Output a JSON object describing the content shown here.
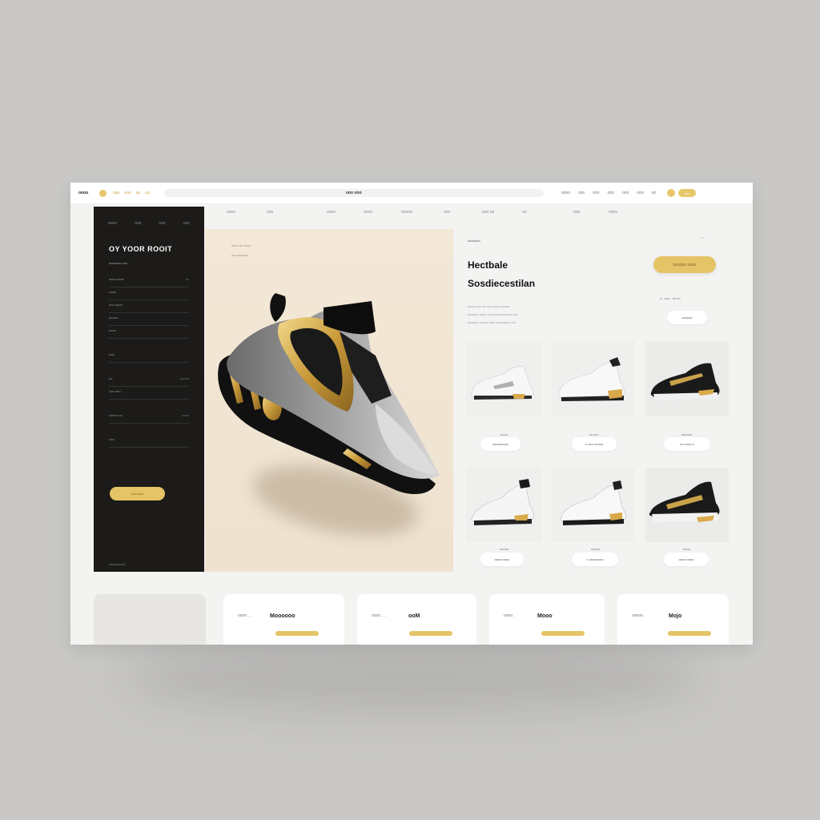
{
  "topbar": {
    "brand": "ooou",
    "nav": [
      "uuu",
      "uuu",
      "uu",
      "uu"
    ],
    "search_text": "ooo ooo",
    "right_nav": [
      "oooo",
      "ooo",
      "ooo",
      "ooo",
      "ooo",
      "ooo",
      "oo"
    ],
    "pill": "ooo"
  },
  "subnav": [
    "oooo",
    "ooo",
    "oooo",
    "oooo",
    "ooooo",
    "ooo",
    "ooo oo",
    "oo",
    "ooo",
    "oooo"
  ],
  "sidebar": {
    "tabs": [
      "oooo",
      "ooo",
      "ooo",
      "ooo"
    ],
    "title": "OY YOOR ROOIT",
    "subtitle": "ooooooo ooo",
    "rows": [
      {
        "label": "oooo oooo",
        "right": "oo"
      },
      {
        "label": "oooo",
        "right": ""
      },
      {
        "label": "ooo oooo",
        "right": ""
      },
      {
        "label": "ooooo",
        "right": ""
      },
      {
        "label": "oooo",
        "right": ""
      },
      {
        "label": "ooo",
        "right": ""
      },
      {
        "label": "oo",
        "right": "ooooo"
      },
      {
        "label": "ooo ooo",
        "right": ""
      },
      {
        "label": "ooooo oo",
        "right": "oooo"
      },
      {
        "label": "ooo",
        "right": ""
      }
    ],
    "cta": "ooooooo",
    "footer": "ooooooooo"
  },
  "hero": {
    "label1": "oooo oo oooo",
    "label2": "ooo oooooo"
  },
  "product": {
    "tag": "ooooooo",
    "corner": "o  o",
    "title_line1": "Hectbale",
    "title_line2": "Sosdiecestilan",
    "description": [
      "oooo ooo oo ooo oooo ooooo",
      "oooooo oooo oo oooooooooooo oo",
      "oooooo ooooo ooo oooooooo ooo"
    ],
    "cta": "oooooo oooo",
    "price_row": "o . ooo . oo oo",
    "secondary_pill": "oooooo"
  },
  "grid": [
    {
      "caption": "oooo",
      "pill": "ooooooooo"
    },
    {
      "caption": "oo ooo",
      "pill": "o ooo ooooo"
    },
    {
      "caption": "oooooo",
      "pill": "oo oooo  o"
    },
    {
      "caption": "ooooo",
      "pill": "oooo oooo"
    },
    {
      "caption": "ooooo",
      "pill": "o oooooooo"
    },
    {
      "caption": "oooo",
      "pill": "oooo oooo"
    }
  ],
  "bottom_cards": [
    {
      "label": "",
      "value": ""
    },
    {
      "label": "oooo   .  .",
      "value": "Moooooo"
    },
    {
      "label": "oooo   .  .  .",
      "value": "ooM"
    },
    {
      "label": "oooo   .",
      "value": "Mooo"
    },
    {
      "label": "ooooo   .",
      "value": "Mojo"
    }
  ],
  "colors": {
    "accent_gold": "#e4c466",
    "sidebar_bg": "#1c1b19",
    "hero_bg": "#f0e4d3"
  }
}
